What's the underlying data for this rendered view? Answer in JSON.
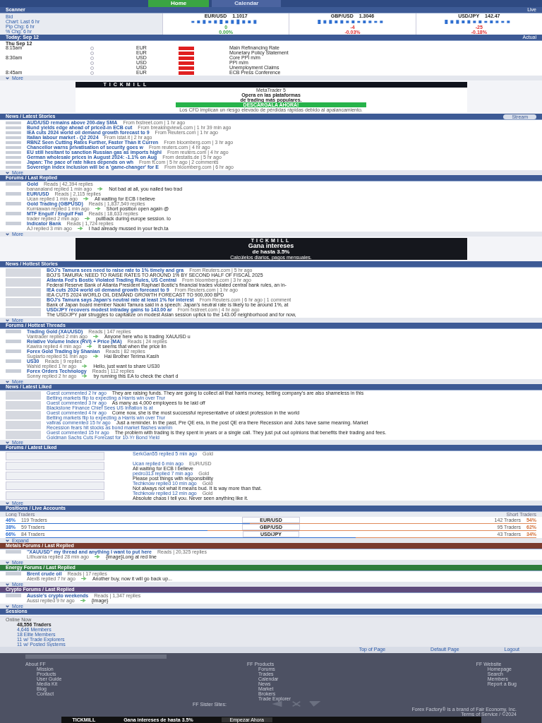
{
  "nav": {
    "tabs": [
      {
        "label": "Home",
        "selected": true
      },
      {
        "label": "Calendar",
        "selected": false
      }
    ]
  },
  "scanner": {
    "title": "Scanner",
    "mode": "Live",
    "labels": [
      "Bid",
      "Chart: Last 6 hr",
      "Pip Chg: 6 hr",
      "% Chg: 6 hr"
    ],
    "pairs": [
      {
        "pair": "EUR/USD",
        "bid": "1.1017",
        "pips": "0",
        "pct": "0.00%",
        "negative": false
      },
      {
        "pair": "GBP/USD",
        "bid": "1.3046",
        "pips": "-4",
        "pct": "-0.03%",
        "negative": true
      },
      {
        "pair": "USD/JPY",
        "bid": "142.47",
        "pips": "-25",
        "pct": "-0.18%",
        "negative": true
      }
    ]
  },
  "calendar": {
    "title": "Today: Sep 12",
    "actual_label": "Actual",
    "day": "Thu Sep 12",
    "rows": [
      {
        "time": "8:15am",
        "currency": "EUR",
        "high_impact": true,
        "event": "Main Refinancing Rate"
      },
      {
        "time": "",
        "currency": "EUR",
        "high_impact": true,
        "event": "Monetary Policy Statement"
      },
      {
        "time": "8:30am",
        "currency": "USD",
        "high_impact": true,
        "event": "Core PPI m/m"
      },
      {
        "time": "",
        "currency": "USD",
        "high_impact": true,
        "event": "PPI m/m"
      },
      {
        "time": "",
        "currency": "USD",
        "high_impact": true,
        "event": "Unemployment Claims"
      },
      {
        "time": "8:45am",
        "currency": "EUR",
        "high_impact": true,
        "event": "ECB Press Conference"
      }
    ],
    "more": "More"
  },
  "ad_top": {
    "brand": "TICKMILL",
    "product": "MetaTrader 5",
    "lines": [
      "Opera en las plataformas",
      "de trading más populares."
    ],
    "cta": "DESCÁRGALA AHORA!",
    "disclaimer": "Los CFD implican un riesgo elevado de pérdidas rápidas debido al apalancamiento."
  },
  "latest_stories": {
    "title": "News / Latest Stories",
    "toggle": "Stream",
    "items": [
      {
        "title": "AUD/USD remains above 200-day SMA",
        "meta": "From fxstreet.com | 1 hr ago"
      },
      {
        "title": "Bund yields edge ahead of priced-in ECB cut",
        "meta": "From breakingviews.com | 1 hr 39 min ago"
      },
      {
        "title": "IEA cuts 2024 world oil demand growth forecast to 9",
        "meta": "From Reuters.com | 1 hr ago"
      },
      {
        "title": "Italian labour market - Q2 2024",
        "meta": "From istat.it | 2 hr ago"
      },
      {
        "title": "RBNZ Seen Cutting Rates Further, Faster Than It Curren",
        "meta": "From bloomberg.com | 3 hr ago"
      },
      {
        "title": "Chancellor warns privatisation of security goes w",
        "meta": "From reuters.com | 4 hr ago"
      },
      {
        "title": "EU still hesitant to sanction Russian gas as imports highl",
        "meta": "From reuters.com | 4 hr ago"
      },
      {
        "title": "German wholesale prices in August 2024: -1.1% on Aug",
        "meta": "From destatis.de | 5 hr ago"
      },
      {
        "title": "Japan: The pace of rate hikes depends on wh",
        "meta": "From ft.com | 5 hr ago | 2 comments"
      },
      {
        "title": "Sovereign index inclusion will be a 'game-changer' for E",
        "meta": "From bloomberg.com | 6 hr ago"
      }
    ],
    "more": "More"
  },
  "last_replied": {
    "title": "Forums / Last Replied",
    "items": [
      {
        "title": "Gold",
        "meta": "Reads | 42,394 replies",
        "reply_by": "bananaland replied 1 min ago",
        "excerpt": "Not bad at all, you nailed two trad"
      },
      {
        "title": "EUR/USD",
        "meta": "Reads | 2,115 replies",
        "reply_by": "Ucan replied 1 min ago",
        "excerpt": "All waiting for ECB I believe"
      },
      {
        "title": "Gold Trading (GBPUSD)",
        "meta": "Reads | 1,837,549 replies",
        "reply_by": "Kurniawan replied 1 min ago",
        "excerpt": "Short position open again @"
      },
      {
        "title": "MTF Engulf / Engulf Fail",
        "meta": "Reads | 18,633 replies",
        "reply_by": "trader replied 2 min ago",
        "excerpt": "pullback during europe session. lo"
      },
      {
        "title": "Indicator Bank",
        "meta": "Reads | 1,724 replies",
        "reply_by": "AJ replied 3 min ago",
        "excerpt": "I had already mussed in your tech.ta"
      }
    ],
    "more": "More"
  },
  "ad_mid": {
    "brand": "TICKMILL",
    "headline": "Gana intereses",
    "sub": "de hasta 3.5%",
    "line": "Calcúlelos diarios, pagos mensuales."
  },
  "hottest_stories": {
    "title": "News / Hottest Stories",
    "items": [
      {
        "title": "BOJ's Tamura sees need to raise rate to 1% timely and gra",
        "meta": "From Reuters.com | 5 hr ago",
        "summary": "BOJ'S TAMURA: NEED TO RAISE RATES TO AROUND 1% BY SECOND HALF OF FISCAL 2025"
      },
      {
        "title": "Atlanta Fed's Bostic Violated Trading Rules, US Central",
        "meta": "From bloomberg.com | 3 hr ago",
        "summary": "Federal Reserve Bank of Atlanta President Raphael Bostic's financial trades violated central bank rules, an in-"
      },
      {
        "title": "IEA cuts 2024 world oil demand growth forecast to 9",
        "meta": "From Reuters.com | 1 hr ago",
        "summary": "IEA CUTS 2024 WORLD OIL DEMAND GROWTH FORECAST TO 900,000 BPD"
      },
      {
        "title": "BOJ's Tamura says Japan's neutral rate at least 1% for interest",
        "meta": "From Reuters.com | 6 hr ago | 1 comment",
        "summary": "Bank of Japan board member Naoki Tamura said in a speech: Japan's neutral rate is likely to be around 1%, at"
      },
      {
        "title": "USD/JPY recovers modest intraday gains to 143.00 ar",
        "meta": "From fxstreet.com | 4 hr ago",
        "summary": "The USD/JPY pair struggles to capitalize on modest Asian session uptick to the 143.00 neighborhood and for now,"
      }
    ],
    "more": "More"
  },
  "hottest_threads": {
    "title": "Forums / Hottest Threads",
    "items": [
      {
        "title": "Trading Gold (XAUUSD)",
        "meta": "Reads | 147 replies",
        "reply_by": "Vantrader replied 2 min ago",
        "excerpt": "Anyone here who is trading XAUUSD u"
      },
      {
        "title": "Relative Volume Index (RVI) + Price (MA)",
        "meta": "Reads | 24 replies",
        "reply_by": "Kawira replied 4 min ago",
        "excerpt": "It seems that when the price lin"
      },
      {
        "title": "Forex Gold Trading by Shanian",
        "meta": "Reads | 82 replies",
        "reply_by": "Sugiarto replied 51 min ago",
        "excerpt": "Hai Brother Terima Kasih"
      },
      {
        "title": "US30",
        "meta": "Reads | 9 replies",
        "reply_by": "Wahid replied 1 hr ago",
        "excerpt": "Hello, just want to share US30"
      },
      {
        "title": "Forex Orders Technology",
        "meta": "Reads | 112 replies",
        "reply_by": "Sonny replied 2 hr ago",
        "excerpt": "try running this EA to check the chart d"
      }
    ],
    "more": "More"
  },
  "liked_news": {
    "title": "News / Latest Liked",
    "items": [
      {
        "byline": "Guest commented 2 hr ago",
        "comment": "They are raising funds. They are going to collect all that harris money, betting company's are also shameless in this",
        "story": "Betting markets flip to expecting a Harris win over Trur"
      },
      {
        "byline": "Guest commented 3 hr ago",
        "comment": "As many as 4,000 employees to be laid off",
        "story": "Blackstone Finance Chief Sees US Inflation Is at"
      },
      {
        "byline": "Guest commented 4 hr ago",
        "comment": "Come now, she is the most successful representative of oldest profession in the world",
        "story": "Betting markets flip to expecting a Harris win over Trur"
      },
      {
        "byline": "vafiras commented 15 hr ago",
        "comment": "Just a reminder. In the past, Pre QE era, in the post QE era there Recession and Jobs have same meaning. Market",
        "story": "Recession fears hit stocks as bond market flashes warnin"
      },
      {
        "byline": "Guest commented 15 hr ago",
        "comment": "The problem with trading is they spent in years or a single call. They just put out opinions that benefits their trading and fees.",
        "story": "Goldman Sachs Cuts Forecast for 10-Yr Bond Yield"
      }
    ],
    "more": "More"
  },
  "liked_forums": {
    "title": "Forums / Latest Liked",
    "items": [
      {
        "byline": "SerkGan55 replied 5 min ago",
        "thread": "Gold"
      },
      {
        "byline": "Ucan replied 6 min ago",
        "comment": "All waiting for ECB I believe",
        "thread": "EUR/USD"
      },
      {
        "byline": "pedro313 replied 7 min ago",
        "comment": "Please post things with responsibility",
        "thread": "Gold"
      },
      {
        "byline": "Techknow replied 10 min ago",
        "comment": "Not always not what it means bud. It is way more than that.",
        "thread": "Gold"
      },
      {
        "byline": "Techknow replied 12 min ago",
        "comment": "Absolute chaos I tell you. Never seen anything like it.",
        "thread": "Gold"
      }
    ],
    "more": "More"
  },
  "positions": {
    "title": "Positions / Live Accounts",
    "long_label": "Long Traders",
    "short_label": "Short Traders",
    "rows": [
      {
        "pair": "EUR/USD",
        "long_pct": "46%",
        "long_traders": "119 Traders",
        "short_traders": "142 Traders",
        "short_pct": "54%",
        "level": 0.46
      },
      {
        "pair": "GBP/USD",
        "long_pct": "38%",
        "long_traders": "59 Traders",
        "short_traders": "95 Traders",
        "short_pct": "62%",
        "level": 0.38
      },
      {
        "pair": "USD/JPY",
        "long_pct": "66%",
        "long_traders": "84 Traders",
        "short_traders": "43 Traders",
        "short_pct": "34%",
        "level": 0.66
      }
    ],
    "expand": "Expand"
  },
  "category_forums": [
    {
      "kind": "metals",
      "title": "Metals Forums / Last Replied",
      "thread": "\"XAUUSD\" my thread and anything I want to put here",
      "meta": "Reads | 20,325 replies",
      "reply_by": "Lithuania replied 28 min ago",
      "excerpt": "{image}Long at red line",
      "more": "More"
    },
    {
      "kind": "energy",
      "title": "Energy Forums / Last Replied",
      "thread": "Brent crude oil",
      "meta": "Reads | 17 replies",
      "reply_by": "AlexB replied 7 hr ago",
      "excerpt": "Another buy, now it will go back up...",
      "more": "More"
    },
    {
      "kind": "crypto",
      "title": "Crypto Forums / Last Replied",
      "thread": "Aussie's crypto weekends",
      "meta": "Reads | 1,347 replies",
      "reply_by": "Aussi replied 9 hr ago",
      "excerpt": "{image}",
      "more": "More"
    }
  ],
  "sessions": {
    "title": "Sessions"
  },
  "online": {
    "title": "Online Now",
    "total": "48,556 Traders",
    "items": [
      "4,646 Members",
      "18 Elite Members",
      "11 w/ Trade Explorers",
      "11 w/ Posted Systems"
    ]
  },
  "footer_links": [
    "Top of Page",
    "Default Page",
    "Logout"
  ],
  "footer": {
    "columns": [
      {
        "title": "About FF",
        "links": [
          "Mission",
          "Products",
          "User Guide",
          "Media Kit",
          "Blog",
          "Contact"
        ]
      },
      {
        "title": "FF Products",
        "links": [
          "Forums",
          "Trades",
          "Calendar",
          "News",
          "Market",
          "Brokers",
          "Trade Explorer"
        ]
      },
      {
        "title": "FF Website",
        "links": [
          "Homepage",
          "Search",
          "Members",
          "Report a Bug"
        ]
      }
    ],
    "sister_label": "FF Sister Sites:",
    "legal": "Forex Factory® is a brand of Fair Economy, Inc.",
    "terms": "Terms of Service / ©2024"
  },
  "ad_bottom": {
    "brand": "TICKMILL",
    "headline": "Gana intereses de hasta 3.5%",
    "cta": "Empezar Ahora"
  }
}
